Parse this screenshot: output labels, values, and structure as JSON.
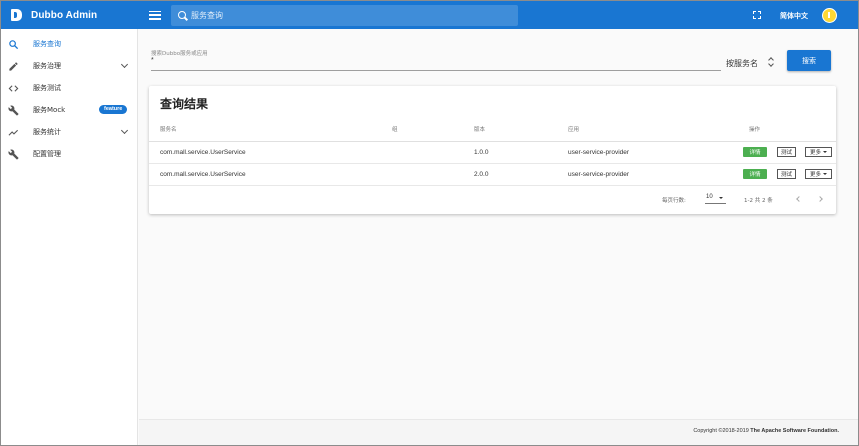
{
  "appbar": {
    "brand": "Dubbo Admin",
    "search_placeholder": "服务查询",
    "language": "简体中文"
  },
  "sidebar": {
    "items": [
      {
        "label": "服务查询",
        "icon": "search-icon",
        "active": true
      },
      {
        "label": "服务治理",
        "icon": "pencil-icon",
        "expandable": true
      },
      {
        "label": "服务测试",
        "icon": "code-icon"
      },
      {
        "label": "服务Mock",
        "icon": "wrench-icon",
        "badge": "feature"
      },
      {
        "label": "服务统计",
        "icon": "trending-icon",
        "expandable": true
      },
      {
        "label": "配置管理",
        "icon": "wrench-icon"
      }
    ]
  },
  "search": {
    "field_label": "搜索Dubbo服务或应用",
    "field_value": "*",
    "select_value": "按服务名",
    "button_label": "搜索"
  },
  "results": {
    "title": "查询结果",
    "columns": [
      "服务名",
      "组",
      "版本",
      "应用",
      "操作"
    ],
    "rows": [
      {
        "service": "com.mall.service.UserService",
        "group": "",
        "version": "1.0.0",
        "app": "user-service-provider"
      },
      {
        "service": "com.mall.service.UserService",
        "group": "",
        "version": "2.0.0",
        "app": "user-service-provider"
      }
    ],
    "actions": {
      "detail": "详情",
      "test": "测试",
      "more": "更多"
    },
    "pager": {
      "rows_per_page_label": "每页行数:",
      "rows_per_page": "10",
      "range": "1-2 共 2 条"
    }
  },
  "footer": {
    "prefix": "Copyright ©2018-2019",
    "org": "The Apache Software Foundation."
  },
  "colors": {
    "primary": "#1976d2",
    "success": "#4caf50",
    "avatar": "#fdd835"
  }
}
